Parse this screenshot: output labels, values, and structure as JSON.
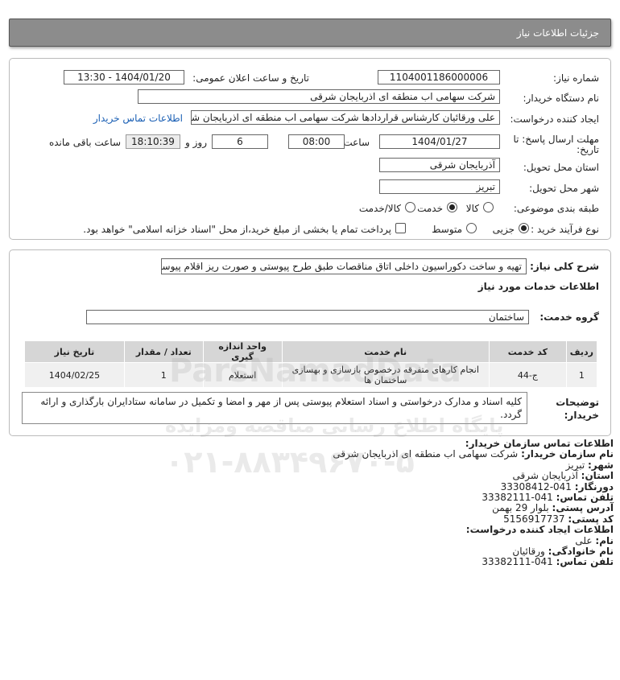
{
  "page": {
    "title": "جزئیات اطلاعات نیاز"
  },
  "need": {
    "number_label": "شماره نیاز:",
    "number": "1104001186000006",
    "announce_label": "تاریخ و ساعت اعلان عمومی:",
    "announce": "1404/01/20 - 13:30",
    "buyer_label": "نام دستگاه خریدار:",
    "buyer": "شرکت سهامی اب منطقه ای اذربایجان شرقی",
    "creator_label": "ایجاد کننده درخواست:",
    "creator": "علی ورقائیان کارشناس قراردادها شرکت سهامی اب منطقه ای اذربایجان شرقی",
    "contact_link": "اطلاعات تماس خریدار",
    "deadline_label_1": "مهلت ارسال پاسخ: تا",
    "deadline_label_2": "تاریخ:",
    "deadline_date": "1404/01/27",
    "time_label": "ساعت",
    "deadline_time": "08:00",
    "days": "6",
    "days_label": "روز و",
    "remaining": "18:10:39",
    "remaining_label": "ساعت باقی مانده",
    "province_label": "استان محل تحویل:",
    "province": "آذربایجان شرقی",
    "city_label": "شهر محل تحویل:",
    "city": "تبریز",
    "category_label": "طبقه بندی موضوعی:",
    "category_options": [
      "کالا",
      "خدمت",
      "کالا/خدمت"
    ],
    "category_selected": 1,
    "process_label": "نوع فرآیند خرید :",
    "process_options": [
      "جزیی",
      "متوسط"
    ],
    "process_selected": 0,
    "payment_note": "پرداخت تمام یا بخشی از مبلغ خرید،از محل \"اسناد خزانه اسلامی\" خواهد بود."
  },
  "details": {
    "summary_label": "شرح کلی نیاز:",
    "summary": "تهیه و ساخت دکوراسیون داخلی اتاق مناقصات طبق طرح پیوستی و صورت ریز اقلام پیوستی",
    "services_heading": "اطلاعات خدمات مورد نیاز",
    "group_label": "گروه خدمت:",
    "group": "ساختمان",
    "table": {
      "headers": [
        "ردیف",
        "کد خدمت",
        "نام خدمت",
        "واحد اندازه گیری",
        "تعداد / مقدار",
        "تاریخ نیاز"
      ],
      "rows": [
        [
          "1",
          "ج-44",
          "انجام کارهای متفرقه درخصوص بازسازی و بهسازی ساختمان ها",
          "استعلام",
          "1",
          "1404/02/25"
        ]
      ]
    },
    "notes_label_1": "توضیحات",
    "notes_label_2": "خریدار:",
    "notes": "کلیه اسناد و مدارک درخواستی و اسناد استعلام پیوستی پس از مهر و امضا و تکمیل در سامانه ستادایران بارگذاری و ارائه گردد."
  },
  "contact": {
    "heading": "اطلاعات تماس سازمان خریدار:",
    "org_label": "نام سازمان خریدار:",
    "org": "شرکت سهامی اب منطقه ای اذربایجان شرقی",
    "city_label": "شهر:",
    "city": "تبریز",
    "province_label": "استان:",
    "province": "آذربایجان شرقی",
    "fax_label": "دورنگار:",
    "fax": "041-33308412",
    "phone_label": "تلفن تماس:",
    "phone": "041-33382111",
    "address_label": "آدرس پستی:",
    "address": "بلوار 29 بهمن",
    "postal_label": "کد پستی:",
    "postal": "5156917737",
    "creator_heading": "اطلاعات ایجاد کننده درخواست:",
    "name_label": "نام:",
    "name": "علی",
    "family_label": "نام خانوادگی:",
    "family": "ورقائیان",
    "creator_phone_label": "تلفن تماس:",
    "creator_phone": "041-33382111"
  },
  "watermark": {
    "line1": "ParsNamadData",
    "line2": "پایگاه اطلاع رسانی مناقصه ومزایده",
    "line3": "۰۲۱-۸۸۳۴۹۶۷۰-۵"
  }
}
